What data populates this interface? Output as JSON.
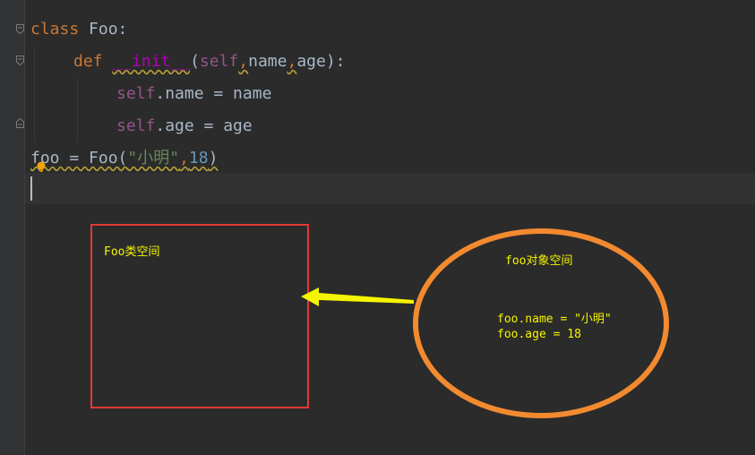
{
  "editor": {
    "line1": {
      "kw": "class",
      "name": " Foo:"
    },
    "line2": {
      "kw": "def",
      "fn": "__init__",
      "open": "(",
      "self": "self",
      "c1": ",",
      "p1": "name",
      "c2": ",",
      "p2": "age",
      "close": "):"
    },
    "line3": {
      "self": "self",
      "rest": ".name = name"
    },
    "line4": {
      "self": "self",
      "rest": ".age = age"
    },
    "line5": {
      "pre": "foo = Foo(",
      "str": "\"小明\"",
      "comma": ",",
      "num": "18",
      "close": ")"
    }
  },
  "diagram": {
    "class_box_label": "Foo类空间",
    "object_label": "foo对象空间",
    "object_line1": "foo.name = \"小明\"",
    "object_line2": "foo.age = 18",
    "colors": {
      "box": "#e03b35",
      "ellipse": "#f28a30",
      "arrow": "#f5f500",
      "text": "#f5f500"
    }
  }
}
